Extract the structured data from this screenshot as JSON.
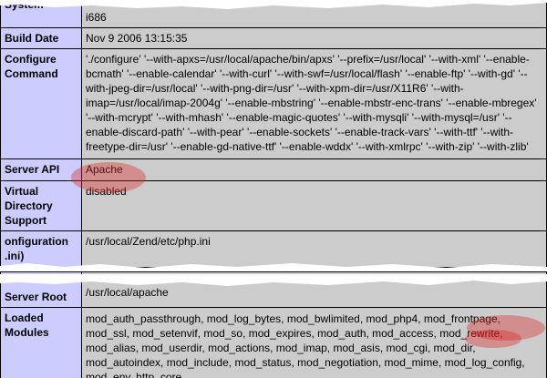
{
  "fragment1": {
    "rows": [
      {
        "key": "System",
        "value": "i686"
      },
      {
        "key": "Build Date",
        "value": "Nov 9 2006 13:15:35"
      },
      {
        "key": "Configure Command",
        "value": "'./configure' '--with-apxs=/usr/local/apache/bin/apxs' '--prefix=/usr/local' '--with-xml' '--enable-bcmath' '--enable-calendar' '--with-curl' '--with-swf=/usr/local/flash' '--enable-ftp' '--with-gd' '--with-jpeg-dir=/usr/local' '--with-png-dir=/usr' '--with-xpm-dir=/usr/X11R6' '--with-imap=/usr/local/imap-2004g' '--enable-mbstring' '--enable-mbstr-enc-trans' '--enable-mbregex' '--with-mcrypt' '--with-mhash' '--enable-magic-quotes' '--with-mysqli' '--with-mysql=/usr' '--enable-discard-path' '--with-pear' '--enable-sockets' '--enable-track-vars' '--with-ttf' '--with-freetype-dir=/usr' '--enable-gd-native-ttf' '--enable-wddx' '--with-xmlrpc' '--with-zip' '--with-zlib'"
      },
      {
        "key": "Server API",
        "value": "Apache"
      },
      {
        "key": "Virtual Directory Support",
        "value": "disabled"
      },
      {
        "key": "onfiguration\n.ini)",
        "value": "/usr/local/Zend/etc/php.ini"
      }
    ]
  },
  "fragment2": {
    "rows": [
      {
        "key": "Server Root",
        "value": "/usr/local/apache"
      },
      {
        "key": "Loaded Modules",
        "value": "mod_auth_passthrough, mod_log_bytes, mod_bwlimited, mod_php4, mod_frontpage, mod_ssl, mod_setenvif, mod_so, mod_expires, mod_auth, mod_access, mod_rewrite, mod_alias, mod_userdir, mod_actions, mod_imap, mod_asis, mod_cgi, mod_dir, mod_autoindex, mod_include, mod_status, mod_negotiation, mod_mime, mod_log_config, mod_env, http_core"
      }
    ]
  },
  "colors": {
    "key_cell": "#ccccff",
    "value_cell": "#cccccc",
    "highlight": "#dc2828"
  }
}
